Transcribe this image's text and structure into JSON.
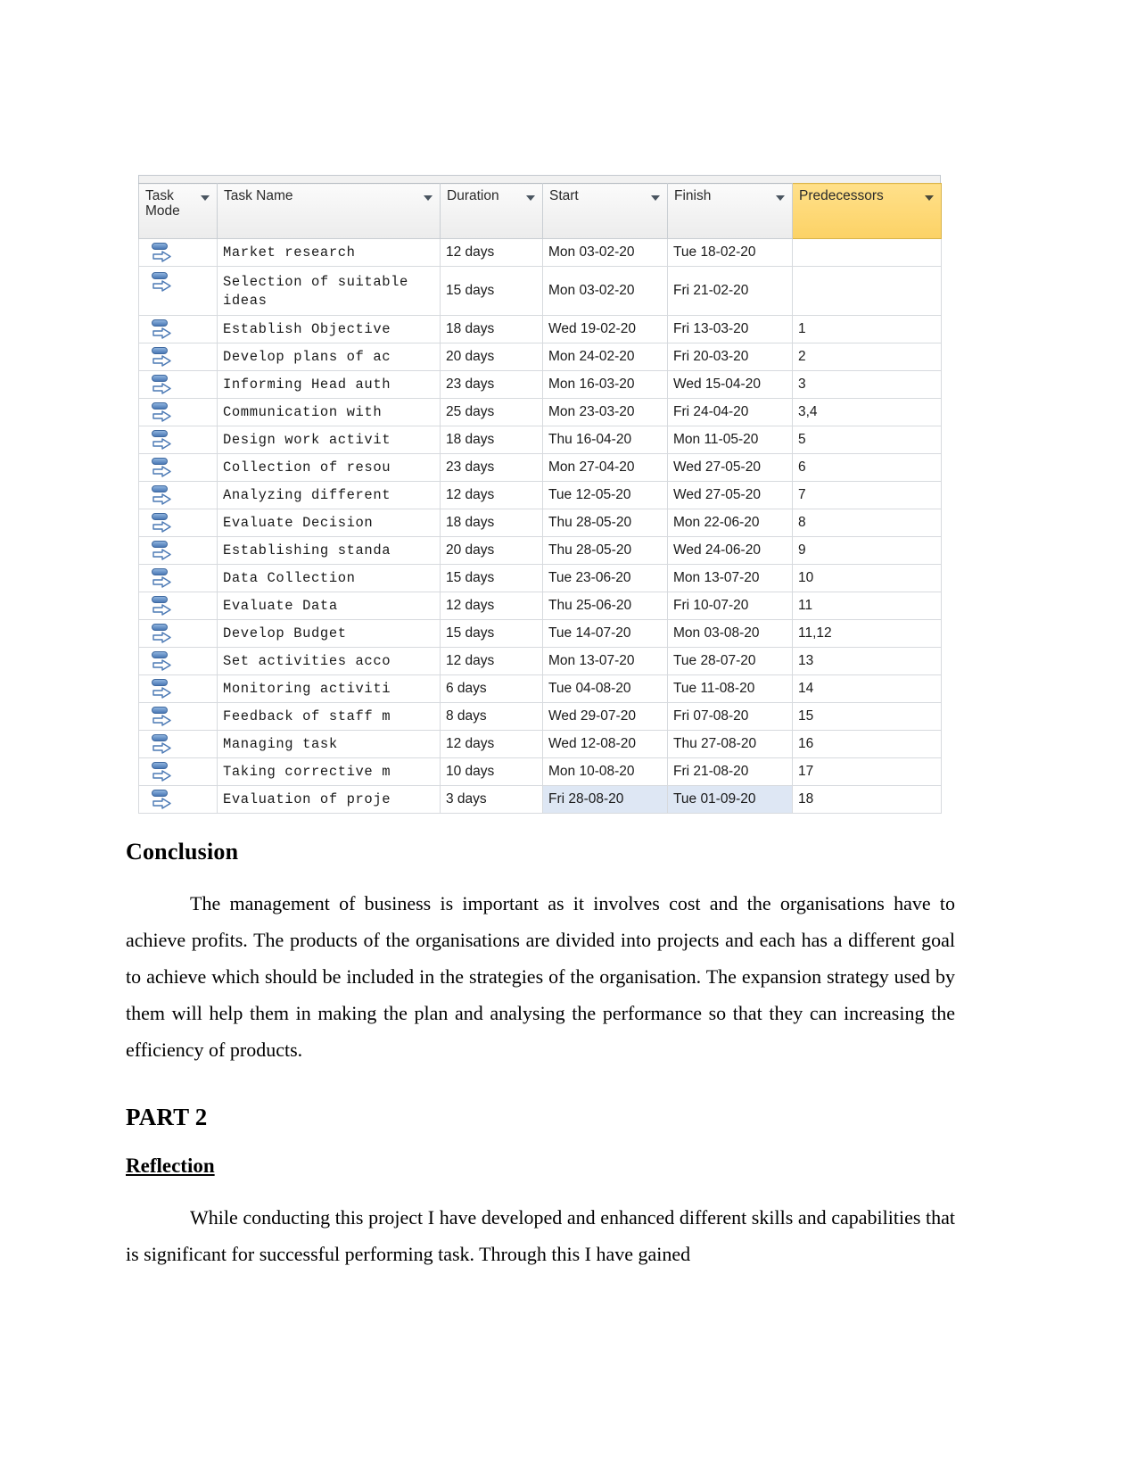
{
  "project_table": {
    "columns": [
      {
        "label": "Task Mode",
        "key": "mode",
        "has_filter": true,
        "highlighted": false
      },
      {
        "label": "Task Name",
        "key": "name",
        "has_filter": true,
        "highlighted": false
      },
      {
        "label": "Duration",
        "key": "duration",
        "has_filter": true,
        "highlighted": false
      },
      {
        "label": "Start",
        "key": "start",
        "has_filter": true,
        "highlighted": false
      },
      {
        "label": "Finish",
        "key": "finish",
        "has_filter": true,
        "highlighted": false
      },
      {
        "label": "Predecessors",
        "key": "predecessors",
        "has_filter": true,
        "highlighted": true
      }
    ],
    "header_highlight_color": "#fcd265",
    "selection_color": "#dee7f4",
    "task_mode_icon": "auto-scheduled-icon",
    "rows": [
      {
        "mode": "auto-scheduled-icon",
        "name": "Market research",
        "duration": "12 days",
        "start": "Mon 03-02-20",
        "finish": "Tue 18-02-20",
        "predecessors": "",
        "tall": false,
        "selected": false
      },
      {
        "mode": "auto-scheduled-icon",
        "name": "Selection of suitable ideas",
        "duration": "15 days",
        "start": "Mon 03-02-20",
        "finish": "Fri 21-02-20",
        "predecessors": "",
        "tall": true,
        "selected": false
      },
      {
        "mode": "auto-scheduled-icon",
        "name": "Establish Objective",
        "duration": "18 days",
        "start": "Wed 19-02-20",
        "finish": "Fri 13-03-20",
        "predecessors": "1",
        "tall": false,
        "selected": false
      },
      {
        "mode": "auto-scheduled-icon",
        "name": "Develop plans of ac",
        "duration": "20 days",
        "start": "Mon 24-02-20",
        "finish": "Fri 20-03-20",
        "predecessors": "2",
        "tall": false,
        "selected": false
      },
      {
        "mode": "auto-scheduled-icon",
        "name": "Informing Head auth",
        "duration": "23 days",
        "start": "Mon 16-03-20",
        "finish": "Wed 15-04-20",
        "predecessors": "3",
        "tall": false,
        "selected": false
      },
      {
        "mode": "auto-scheduled-icon",
        "name": "Communication with",
        "duration": "25 days",
        "start": "Mon 23-03-20",
        "finish": "Fri 24-04-20",
        "predecessors": "3,4",
        "tall": false,
        "selected": false
      },
      {
        "mode": "auto-scheduled-icon",
        "name": "Design work activit",
        "duration": "18 days",
        "start": "Thu 16-04-20",
        "finish": "Mon 11-05-20",
        "predecessors": "5",
        "tall": false,
        "selected": false
      },
      {
        "mode": "auto-scheduled-icon",
        "name": "Collection of resou",
        "duration": "23 days",
        "start": "Mon 27-04-20",
        "finish": "Wed 27-05-20",
        "predecessors": "6",
        "tall": false,
        "selected": false
      },
      {
        "mode": "auto-scheduled-icon",
        "name": "Analyzing different",
        "duration": "12 days",
        "start": "Tue 12-05-20",
        "finish": "Wed 27-05-20",
        "predecessors": "7",
        "tall": false,
        "selected": false
      },
      {
        "mode": "auto-scheduled-icon",
        "name": "Evaluate Decision",
        "duration": "18 days",
        "start": "Thu 28-05-20",
        "finish": "Mon 22-06-20",
        "predecessors": "8",
        "tall": false,
        "selected": false
      },
      {
        "mode": "auto-scheduled-icon",
        "name": "Establishing standa",
        "duration": "20 days",
        "start": "Thu 28-05-20",
        "finish": "Wed 24-06-20",
        "predecessors": "9",
        "tall": false,
        "selected": false
      },
      {
        "mode": "auto-scheduled-icon",
        "name": "Data Collection",
        "duration": "15 days",
        "start": "Tue 23-06-20",
        "finish": "Mon 13-07-20",
        "predecessors": "10",
        "tall": false,
        "selected": false
      },
      {
        "mode": "auto-scheduled-icon",
        "name": "Evaluate Data",
        "duration": "12 days",
        "start": "Thu 25-06-20",
        "finish": "Fri 10-07-20",
        "predecessors": "11",
        "tall": false,
        "selected": false
      },
      {
        "mode": "auto-scheduled-icon",
        "name": "Develop Budget",
        "duration": "15 days",
        "start": "Tue 14-07-20",
        "finish": "Mon 03-08-20",
        "predecessors": "11,12",
        "tall": false,
        "selected": false
      },
      {
        "mode": "auto-scheduled-icon",
        "name": "Set activities acco",
        "duration": "12 days",
        "start": "Mon 13-07-20",
        "finish": "Tue 28-07-20",
        "predecessors": "13",
        "tall": false,
        "selected": false
      },
      {
        "mode": "auto-scheduled-icon",
        "name": "Monitoring activiti",
        "duration": "6 days",
        "start": "Tue 04-08-20",
        "finish": "Tue 11-08-20",
        "predecessors": "14",
        "tall": false,
        "selected": false
      },
      {
        "mode": "auto-scheduled-icon",
        "name": "Feedback of staff m",
        "duration": "8 days",
        "start": "Wed 29-07-20",
        "finish": "Fri 07-08-20",
        "predecessors": "15",
        "tall": false,
        "selected": false
      },
      {
        "mode": "auto-scheduled-icon",
        "name": "Managing task",
        "duration": "12 days",
        "start": "Wed 12-08-20",
        "finish": "Thu 27-08-20",
        "predecessors": "16",
        "tall": false,
        "selected": false
      },
      {
        "mode": "auto-scheduled-icon",
        "name": "Taking corrective m",
        "duration": "10 days",
        "start": "Mon 10-08-20",
        "finish": "Fri 21-08-20",
        "predecessors": "17",
        "tall": false,
        "selected": false
      },
      {
        "mode": "auto-scheduled-icon",
        "name": "Evaluation of proje",
        "duration": "3 days",
        "start": "Fri 28-08-20",
        "finish": "Tue 01-09-20",
        "predecessors": "18",
        "tall": false,
        "selected": true
      }
    ]
  },
  "document": {
    "conclusion": {
      "heading": "Conclusion",
      "paragraph": "The management of business is important as it involves cost and the organisations have to achieve profits. The products of the organisations are divided into projects and each has a different goal to achieve which should be included in the strategies of the organisation. The expansion strategy used by them will help them in making the plan and analysing the performance so that they can increasing the efficiency of products."
    },
    "part2": {
      "heading": "PART 2",
      "subheading": "Reflection",
      "paragraph": "While conducting this project I have developed and enhanced different skills and capabilities that is significant for successful performing task. Through this I have gained"
    }
  }
}
